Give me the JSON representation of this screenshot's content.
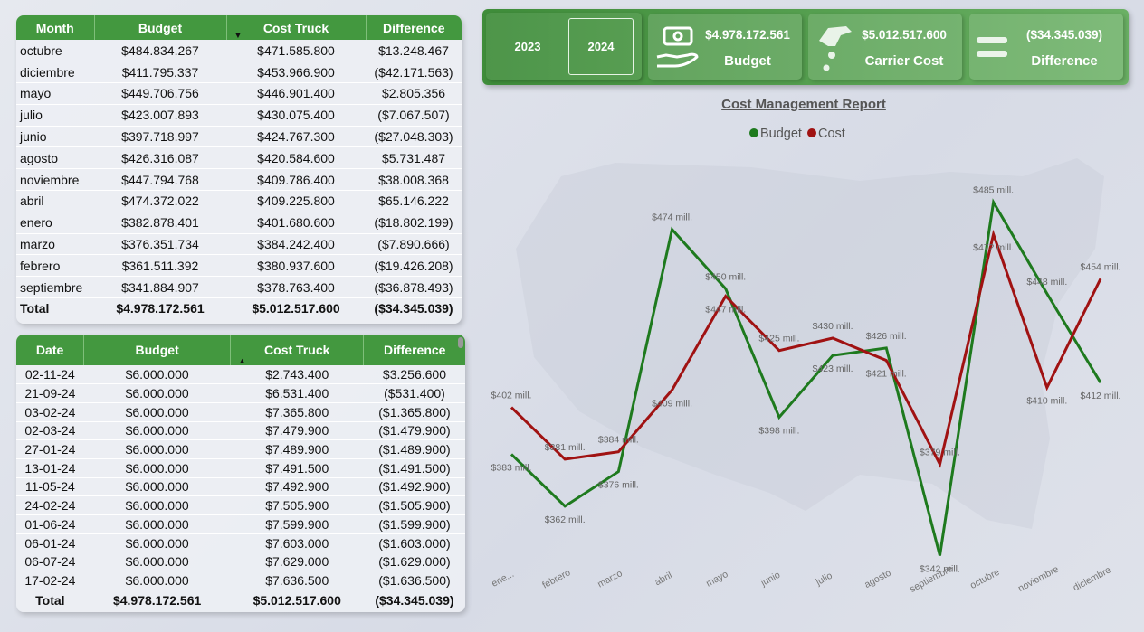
{
  "banner": {
    "years": [
      "2023",
      "2024"
    ],
    "selected_year": "2024",
    "kpis": [
      {
        "value": "$4.978.172.561",
        "label": "Budget",
        "icon": "money-hand-icon"
      },
      {
        "value": "$5.012.517.600",
        "label": "Carrier Cost",
        "icon": "hand-coins-icon"
      },
      {
        "value": "($34.345.039)",
        "label": "Difference",
        "icon": "equals-icon"
      }
    ]
  },
  "month_table": {
    "headers": [
      "Month",
      "Budget",
      "Cost Truck",
      "Difference"
    ],
    "rows": [
      [
        "octubre",
        "$484.834.267",
        "$471.585.800",
        "$13.248.467"
      ],
      [
        "diciembre",
        "$411.795.337",
        "$453.966.900",
        "($42.171.563)"
      ],
      [
        "mayo",
        "$449.706.756",
        "$446.901.400",
        "$2.805.356"
      ],
      [
        "julio",
        "$423.007.893",
        "$430.075.400",
        "($7.067.507)"
      ],
      [
        "junio",
        "$397.718.997",
        "$424.767.300",
        "($27.048.303)"
      ],
      [
        "agosto",
        "$426.316.087",
        "$420.584.600",
        "$5.731.487"
      ],
      [
        "noviembre",
        "$447.794.768",
        "$409.786.400",
        "$38.008.368"
      ],
      [
        "abril",
        "$474.372.022",
        "$409.225.800",
        "$65.146.222"
      ],
      [
        "enero",
        "$382.878.401",
        "$401.680.600",
        "($18.802.199)"
      ],
      [
        "marzo",
        "$376.351.734",
        "$384.242.400",
        "($7.890.666)"
      ],
      [
        "febrero",
        "$361.511.392",
        "$380.937.600",
        "($19.426.208)"
      ],
      [
        "septiembre",
        "$341.884.907",
        "$378.763.400",
        "($36.878.493)"
      ]
    ],
    "total": [
      "Total",
      "$4.978.172.561",
      "$5.012.517.600",
      "($34.345.039)"
    ]
  },
  "date_table": {
    "headers": [
      "Date",
      "Budget",
      "Cost Truck",
      "Difference"
    ],
    "rows": [
      [
        "02-11-24",
        "$6.000.000",
        "$2.743.400",
        "$3.256.600"
      ],
      [
        "21-09-24",
        "$6.000.000",
        "$6.531.400",
        "($531.400)"
      ],
      [
        "03-02-24",
        "$6.000.000",
        "$7.365.800",
        "($1.365.800)"
      ],
      [
        "02-03-24",
        "$6.000.000",
        "$7.479.900",
        "($1.479.900)"
      ],
      [
        "27-01-24",
        "$6.000.000",
        "$7.489.900",
        "($1.489.900)"
      ],
      [
        "13-01-24",
        "$6.000.000",
        "$7.491.500",
        "($1.491.500)"
      ],
      [
        "11-05-24",
        "$6.000.000",
        "$7.492.900",
        "($1.492.900)"
      ],
      [
        "24-02-24",
        "$6.000.000",
        "$7.505.900",
        "($1.505.900)"
      ],
      [
        "01-06-24",
        "$6.000.000",
        "$7.599.900",
        "($1.599.900)"
      ],
      [
        "06-01-24",
        "$6.000.000",
        "$7.603.000",
        "($1.603.000)"
      ],
      [
        "06-07-24",
        "$6.000.000",
        "$7.629.000",
        "($1.629.000)"
      ],
      [
        "17-02-24",
        "$6.000.000",
        "$7.636.500",
        "($1.636.500)"
      ]
    ],
    "total": [
      "Total",
      "$4.978.172.561",
      "$5.012.517.600",
      "($34.345.039)"
    ]
  },
  "chart_data": {
    "type": "line",
    "title": "Cost Management Report",
    "categories": [
      "ene...",
      "febrero",
      "marzo",
      "abril",
      "mayo",
      "junio",
      "julio",
      "agosto",
      "septiembre",
      "octubre",
      "noviembre",
      "diciembre"
    ],
    "series": [
      {
        "name": "Budget",
        "color": "#1e7a1e",
        "values": [
          383,
          362,
          376,
          474,
          450,
          398,
          423,
          426,
          342,
          485,
          448,
          412
        ],
        "labels": [
          "$383 mill.",
          "$362 mill.",
          "$376 mill.",
          "$474 mill.",
          "$450 mill.",
          "$398 mill.",
          "$423 mill.",
          "$426 mill.",
          "$342 mill.",
          "$485 mill.",
          "$448 mill.",
          "$412 mill."
        ]
      },
      {
        "name": "Cost",
        "color": "#a01212",
        "values": [
          402,
          381,
          384,
          409,
          447,
          425,
          430,
          421,
          379,
          472,
          410,
          454
        ],
        "labels": [
          "$402 mill.",
          "$381 mill.",
          "$384 mill.",
          "$409 mill.",
          "$447 mill.",
          "$425 mill.",
          "$430 mill.",
          "$421 mill.",
          "$379 mill.",
          "$472 mill.",
          "$410 mill.",
          "$454 mill."
        ]
      }
    ],
    "legend_position": "top",
    "grid": false
  }
}
